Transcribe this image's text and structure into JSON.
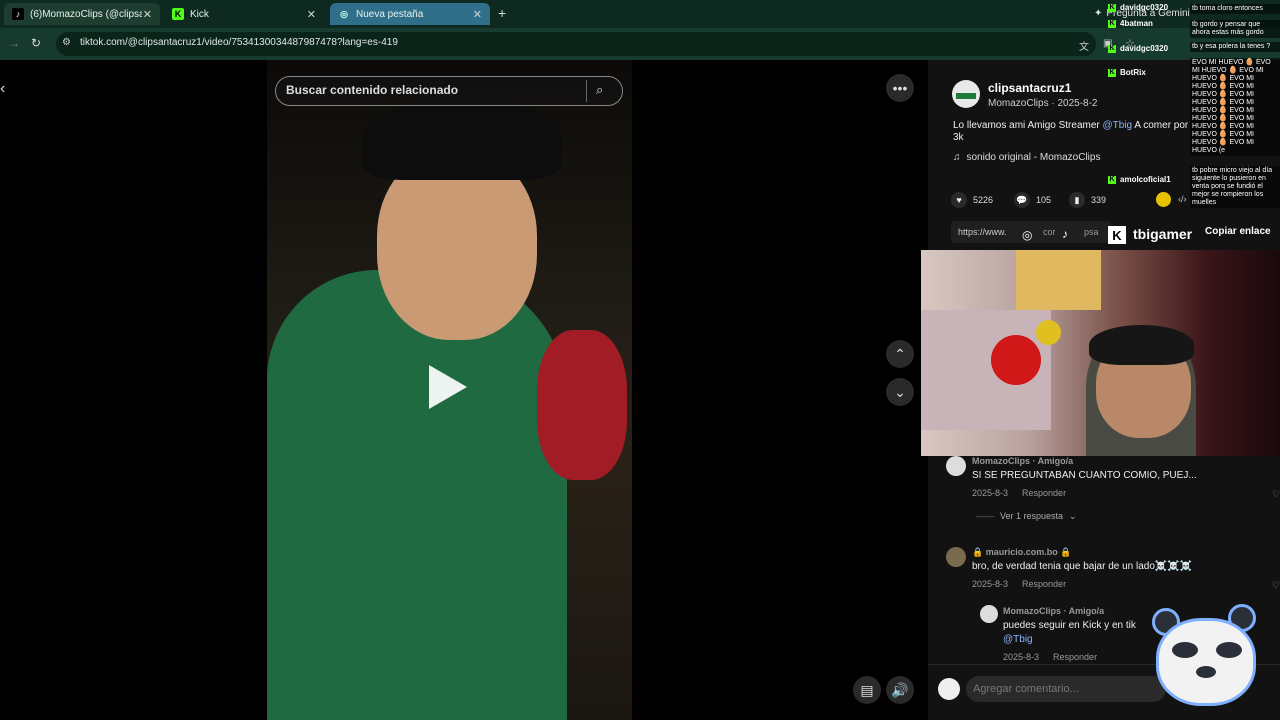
{
  "browser": {
    "tabs": [
      {
        "title": "(6)MomazoClips (@clipsantacr",
        "favicon": "tiktok-icon"
      },
      {
        "title": "Kick",
        "favicon": "kick-icon"
      },
      {
        "title": "Nueva pestaña",
        "favicon": "globe-icon"
      }
    ],
    "url": "tiktok.com/@clipsantacruz1/video/7534130034487987478?lang=es-419",
    "gemini_label": "Pregunta a Gemini"
  },
  "video": {
    "search_placeholder": "Buscar contenido relacionado"
  },
  "post": {
    "username": "clipsantacruz1",
    "display": "MomazoClips · 2025-8-2",
    "caption_pre": "Lo llevamos ami Amigo Streamer ",
    "caption_mention": "@Tbig",
    "caption_post": " A comer por 3k",
    "sound": "sonido original - MomazoClips",
    "likes": "5226",
    "comments": "105",
    "saves": "339",
    "link_prefix": "https://www.",
    "link_mid": "cor",
    "link_end": "psa",
    "copy_link": "Copiar enlace"
  },
  "stream": {
    "channel": "tbigamer"
  },
  "comments": [
    {
      "name": "MomazoClips · Amigo/a",
      "text": "SI SE PREGUNTABAN CUANTO COMIO, PUEJ...",
      "date": "2025-8-3",
      "reply": "Responder"
    },
    {
      "name": "🔒 mauricio.com.bo 🔒",
      "text": "bro, de verdad tenia que bajar de un lado☠️☠️☠️",
      "date": "2025-8-3",
      "reply": "Responder"
    },
    {
      "name": "MomazoClips · Amigo/a",
      "text": "puedes seguir en Kick y en tik",
      "mention": "@Tbig",
      "date": "2025-8-3",
      "reply": "Responder"
    }
  ],
  "see_replies": "Ver 1 respuesta",
  "add_comment": "Agregar comentario...",
  "chat": {
    "users": [
      {
        "name": "davidgc0320"
      },
      {
        "name": "4batman"
      },
      {
        "name": "davidgc0320"
      },
      {
        "name": "BotRix"
      },
      {
        "name": "amolcoficial1"
      }
    ],
    "messages": [
      "tb toma cloro entonces",
      "tb gordo y pensar que ahora estas más gordo",
      "tb y esa polera la tenes ?",
      "EVO MI HUEVO 🥚 EVO MI HUEVO 🥚 EVO MI HUEVO 🥚 EVO MI HUEVO 🥚 EVO MI HUEVO 🥚 EVO MI HUEVO 🥚 EVO MI HUEVO 🥚 EVO MI HUEVO 🥚 EVO MI HUEVO 🥚 EVO MI HUEVO 🥚 EVO MI HUEVO 🥚 EVO MI HUEVO (e",
      "tb pobre micro viejo al día siguiente lo pusieron en venta porq se fundió el mejor se rompieron los muelles"
    ]
  }
}
